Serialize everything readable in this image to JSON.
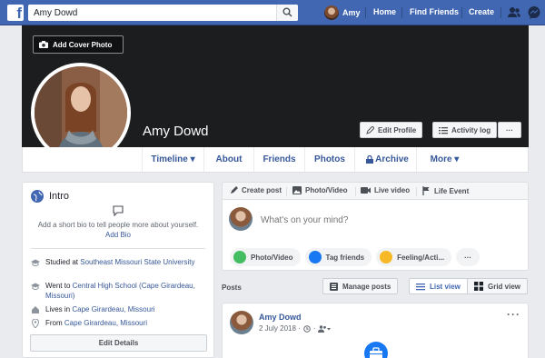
{
  "topbar": {
    "logo": "f",
    "search_value": "Amy Dowd",
    "user_name": "Amy",
    "links": [
      "Home",
      "Find Friends",
      "Create"
    ],
    "brand_color": "#4267b2"
  },
  "cover": {
    "add_cover_label": "Add Cover Photo",
    "profile_name": "Amy Dowd",
    "edit_profile_label": "Edit Profile",
    "activity_log_label": "Activity log",
    "more_label": "···"
  },
  "tabs": [
    {
      "label": "Timeline ▾"
    },
    {
      "label": "About"
    },
    {
      "label": "Friends"
    },
    {
      "label": "Photos"
    },
    {
      "label": "Archive"
    },
    {
      "label": "More ▾"
    }
  ],
  "intro": {
    "title": "Intro",
    "bio_prompt": "Add a short bio to tell people more about yourself.",
    "add_bio": "Add Bio",
    "studied_prefix": "Studied at ",
    "studied_link": "Southeast Missouri State University",
    "went_prefix": "Went to ",
    "went_link": "Central High School (Cape Girardeau, Missouri)",
    "lives_prefix": "Lives in ",
    "lives_link": "Cape Girardeau, Missouri",
    "from_prefix": "From ",
    "from_link": "Cape Girardeau, Missouri",
    "edit_details": "Edit Details"
  },
  "composer": {
    "tabs": [
      "Create post",
      "Photo/Video",
      "Live video",
      "Life Event"
    ],
    "placeholder": "What's on your mind?",
    "actions": [
      "Photo/Video",
      "Tag friends",
      "Feeling/Acti..."
    ],
    "more": "···"
  },
  "posts_bar": {
    "label": "Posts",
    "manage": "Manage posts",
    "list_view": "List view",
    "grid_view": "Grid view"
  },
  "post": {
    "author": "Amy Dowd",
    "date": "2 July 2018 ·",
    "more": "···"
  }
}
